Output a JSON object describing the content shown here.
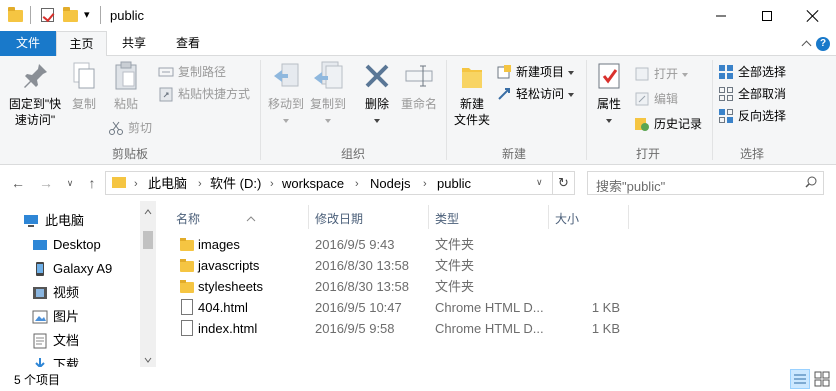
{
  "window": {
    "title": "public",
    "qat_dropdown": "▾"
  },
  "ribbon_tabs": {
    "file": "文件",
    "home": "主页",
    "share": "共享",
    "view": "查看",
    "help": "?"
  },
  "ribbon": {
    "clipboard": {
      "pin_label_line1": "固定到\"快",
      "pin_label_line2": "速访问\"",
      "copy": "复制",
      "paste": "粘贴",
      "copy_path": "复制路径",
      "paste_shortcut": "粘贴快捷方式",
      "cut": "剪切",
      "group_label": "剪贴板"
    },
    "organize": {
      "move_to": "移动到",
      "copy_to": "复制到",
      "delete": "删除",
      "rename": "重命名",
      "group_label": "组织"
    },
    "new": {
      "new_folder_line1": "新建",
      "new_folder_line2": "文件夹",
      "new_item": "新建项目",
      "easy_access": "轻松访问",
      "group_label": "新建"
    },
    "open": {
      "properties": "属性",
      "open": "打开",
      "edit": "编辑",
      "history": "历史记录",
      "group_label": "打开"
    },
    "select": {
      "select_all": "全部选择",
      "select_none": "全部取消",
      "invert": "反向选择",
      "group_label": "选择"
    }
  },
  "address": {
    "crumbs": [
      "此电脑",
      "软件 (D:)",
      "workspace",
      "Nodejs",
      "public"
    ],
    "separator": "›",
    "search_placeholder": "搜索\"public\""
  },
  "nav_pane": {
    "items": [
      {
        "label": "此电脑",
        "icon": "computer-icon"
      },
      {
        "label": "Desktop",
        "icon": "desktop-icon"
      },
      {
        "label": "Galaxy A9",
        "icon": "phone-icon"
      },
      {
        "label": "视频",
        "icon": "video-icon"
      },
      {
        "label": "图片",
        "icon": "pictures-icon"
      },
      {
        "label": "文档",
        "icon": "documents-icon"
      },
      {
        "label": "下载",
        "icon": "download-icon"
      }
    ]
  },
  "file_list": {
    "columns": {
      "name": "名称",
      "date": "修改日期",
      "type": "类型",
      "size": "大小"
    },
    "rows": [
      {
        "name": "images",
        "date": "2016/9/5 9:43",
        "type": "文件夹",
        "size": "",
        "kind": "folder"
      },
      {
        "name": "javascripts",
        "date": "2016/8/30 13:58",
        "type": "文件夹",
        "size": "",
        "kind": "folder"
      },
      {
        "name": "stylesheets",
        "date": "2016/8/30 13:58",
        "type": "文件夹",
        "size": "",
        "kind": "folder"
      },
      {
        "name": "404.html",
        "date": "2016/9/5 10:47",
        "type": "Chrome HTML D...",
        "size": "1 KB",
        "kind": "file"
      },
      {
        "name": "index.html",
        "date": "2016/9/5 9:58",
        "type": "Chrome HTML D...",
        "size": "1 KB",
        "kind": "file"
      }
    ]
  },
  "status_bar": {
    "item_count": "5 个项目"
  },
  "colors": {
    "accent": "#1979ca",
    "folder": "#f5c542",
    "ribbon_bg": "#f5f6f7",
    "header_text": "#4c607a"
  }
}
